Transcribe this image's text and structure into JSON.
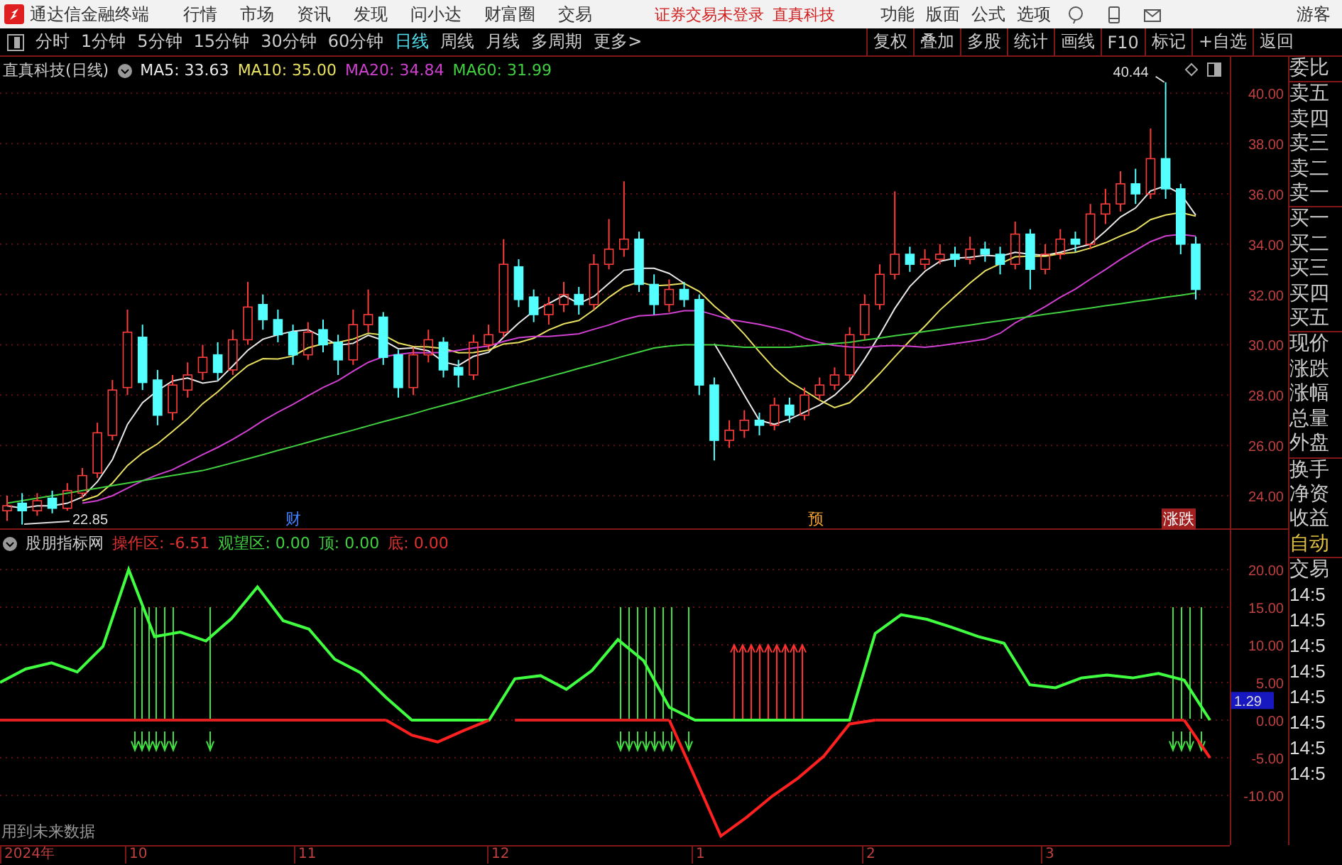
{
  "app": {
    "name": "通达信金融终端"
  },
  "menu": [
    "行情",
    "市场",
    "资讯",
    "发现",
    "问小达",
    "财富圈",
    "交易"
  ],
  "login_status": {
    "message": "证券交易未登录",
    "stock": "直真科技"
  },
  "top_actions": [
    "功能",
    "版面",
    "公式",
    "选项"
  ],
  "user": "游客",
  "periods": [
    {
      "label": "分时",
      "selected": false
    },
    {
      "label": "1分钟",
      "selected": false
    },
    {
      "label": "5分钟",
      "selected": false
    },
    {
      "label": "15分钟",
      "selected": false
    },
    {
      "label": "30分钟",
      "selected": false
    },
    {
      "label": "60分钟",
      "selected": false
    },
    {
      "label": "日线",
      "selected": true
    },
    {
      "label": "周线",
      "selected": false
    },
    {
      "label": "月线",
      "selected": false
    },
    {
      "label": "多周期",
      "selected": false
    },
    {
      "label": "更多>",
      "selected": false
    }
  ],
  "tools": [
    "复权",
    "叠加",
    "多股",
    "统计",
    "画线",
    "F10",
    "标记",
    "+自选",
    "返回"
  ],
  "main_chart": {
    "title": "直真科技(日线)",
    "ma": [
      {
        "label": "MA5: 33.63",
        "color": "#e8e8e8"
      },
      {
        "label": "MA10: 35.00",
        "color": "#e8e060"
      },
      {
        "label": "MA20: 34.84",
        "color": "#d040d0"
      },
      {
        "label": "MA60: 31.99",
        "color": "#40d040"
      }
    ],
    "high_label": "40.44",
    "low_label": "22.85",
    "events": [
      {
        "label": "财",
        "kind": "finance"
      },
      {
        "label": "预",
        "kind": "forecast"
      },
      {
        "label": "涨跌",
        "kind": "limit"
      }
    ],
    "chart_data": {
      "type": "candlestick",
      "grid": true,
      "ylim": [
        22.7,
        41.45
      ],
      "ohlc": [
        [
          23.4,
          24.0,
          23.0,
          23.6
        ],
        [
          23.7,
          24.1,
          22.85,
          23.4
        ],
        [
          23.4,
          24.1,
          23.2,
          23.8
        ],
        [
          23.9,
          24.2,
          23.3,
          23.5
        ],
        [
          23.5,
          24.5,
          23.4,
          24.2
        ],
        [
          24.1,
          25.1,
          23.9,
          24.8
        ],
        [
          24.9,
          26.9,
          24.7,
          26.5
        ],
        [
          26.4,
          28.6,
          26.2,
          28.2
        ],
        [
          28.3,
          31.4,
          28.0,
          30.5
        ],
        [
          30.3,
          30.8,
          28.2,
          28.5
        ],
        [
          28.6,
          29.0,
          26.8,
          27.2
        ],
        [
          27.3,
          28.8,
          27.0,
          28.4
        ],
        [
          28.2,
          29.3,
          27.9,
          28.8
        ],
        [
          28.9,
          30.0,
          28.6,
          29.5
        ],
        [
          29.6,
          30.1,
          28.6,
          28.9
        ],
        [
          29.0,
          30.6,
          28.8,
          30.2
        ],
        [
          30.2,
          32.5,
          30.0,
          31.5
        ],
        [
          31.6,
          32.0,
          30.6,
          31.0
        ],
        [
          31.0,
          31.4,
          30.1,
          30.4
        ],
        [
          30.5,
          30.8,
          29.2,
          29.6
        ],
        [
          29.6,
          30.9,
          29.4,
          30.5
        ],
        [
          30.6,
          31.0,
          29.7,
          30.0
        ],
        [
          30.1,
          30.4,
          28.8,
          29.4
        ],
        [
          29.4,
          31.4,
          29.2,
          30.8
        ],
        [
          30.8,
          32.2,
          30.5,
          31.2
        ],
        [
          31.1,
          31.3,
          29.2,
          29.5
        ],
        [
          29.6,
          29.8,
          27.9,
          28.3
        ],
        [
          28.3,
          29.9,
          28.0,
          29.6
        ],
        [
          29.6,
          30.6,
          29.3,
          30.2
        ],
        [
          30.1,
          30.3,
          28.7,
          29.0
        ],
        [
          29.1,
          29.4,
          28.3,
          28.8
        ],
        [
          28.8,
          30.4,
          28.6,
          30.1
        ],
        [
          30.0,
          30.8,
          29.8,
          30.4
        ],
        [
          30.5,
          34.2,
          30.3,
          33.2
        ],
        [
          33.1,
          33.4,
          31.5,
          31.8
        ],
        [
          31.9,
          32.2,
          30.9,
          31.2
        ],
        [
          31.2,
          31.9,
          30.8,
          31.6
        ],
        [
          31.6,
          32.5,
          31.3,
          32.0
        ],
        [
          32.0,
          32.3,
          31.2,
          31.6
        ],
        [
          31.6,
          33.6,
          31.4,
          33.2
        ],
        [
          33.2,
          35.0,
          33.0,
          33.8
        ],
        [
          33.8,
          36.5,
          33.5,
          34.2
        ],
        [
          34.2,
          34.5,
          32.1,
          32.4
        ],
        [
          32.4,
          32.8,
          31.2,
          31.6
        ],
        [
          31.6,
          32.6,
          31.3,
          32.2
        ],
        [
          32.2,
          32.5,
          31.5,
          31.8
        ],
        [
          31.8,
          32.0,
          28.0,
          28.4
        ],
        [
          28.4,
          28.7,
          25.4,
          26.2
        ],
        [
          26.2,
          27.0,
          25.9,
          26.6
        ],
        [
          26.6,
          27.4,
          26.3,
          27.0
        ],
        [
          27.0,
          27.3,
          26.4,
          26.8
        ],
        [
          26.8,
          27.9,
          26.6,
          27.6
        ],
        [
          27.6,
          27.9,
          26.9,
          27.2
        ],
        [
          27.2,
          28.3,
          27.0,
          28.0
        ],
        [
          28.0,
          28.7,
          27.8,
          28.4
        ],
        [
          28.4,
          29.1,
          28.2,
          28.8
        ],
        [
          28.8,
          30.7,
          28.6,
          30.4
        ],
        [
          30.4,
          32.0,
          30.2,
          31.6
        ],
        [
          31.6,
          33.2,
          31.4,
          32.8
        ],
        [
          32.8,
          36.1,
          32.6,
          33.6
        ],
        [
          33.6,
          33.9,
          32.9,
          33.2
        ],
        [
          33.2,
          33.8,
          33.0,
          33.4
        ],
        [
          33.4,
          34.0,
          33.2,
          33.6
        ],
        [
          33.6,
          33.9,
          33.1,
          33.4
        ],
        [
          33.4,
          34.3,
          33.2,
          33.8
        ],
        [
          33.8,
          34.1,
          33.3,
          33.6
        ],
        [
          33.6,
          33.9,
          32.8,
          33.2
        ],
        [
          33.2,
          34.9,
          33.0,
          34.4
        ],
        [
          34.4,
          34.6,
          32.2,
          33.0
        ],
        [
          33.0,
          34.0,
          32.8,
          33.6
        ],
        [
          33.6,
          34.6,
          33.4,
          34.2
        ],
        [
          34.2,
          34.5,
          33.7,
          34.0
        ],
        [
          34.0,
          35.6,
          33.8,
          35.2
        ],
        [
          35.2,
          36.2,
          34.8,
          35.6
        ],
        [
          35.6,
          36.9,
          35.3,
          36.4
        ],
        [
          36.4,
          37.0,
          35.6,
          36.0
        ],
        [
          36.0,
          38.6,
          35.8,
          37.4
        ],
        [
          37.4,
          40.44,
          35.8,
          36.2
        ],
        [
          36.2,
          36.4,
          33.6,
          34.0
        ],
        [
          34.0,
          34.3,
          31.8,
          32.2
        ]
      ],
      "series": [
        {
          "type": "line",
          "color": "#e8e8e8",
          "values": [
            23.6,
            23.5,
            23.6,
            23.6,
            23.7,
            23.94,
            24.56,
            25.44,
            26.84,
            27.7,
            28.18,
            28.56,
            28.68,
            28.48,
            28.56,
            29.16,
            29.78,
            30.22,
            30.4,
            30.54,
            30.6,
            30.3,
            29.98,
            30.06,
            30.38,
            30.18,
            29.84,
            29.88,
            29.76,
            29.32,
            29.18,
            29.54,
            29.7,
            30.3,
            30.86,
            31.34,
            31.64,
            31.96,
            31.64,
            31.92,
            32.44,
            32.96,
            33.04,
            33.04,
            32.84,
            32.44,
            null,
            30.04,
            29.04,
            28.0,
            27.0,
            26.84,
            27.04,
            27.32,
            27.6,
            28.0,
            28.56,
            29.44,
            30.4,
            31.44,
            32.32,
            32.92,
            33.32,
            33.44,
            33.48,
            33.56,
            33.52,
            33.68,
            33.6,
            33.56,
            33.68,
            33.84,
            34.0,
            34.52,
            35.08,
            35.44,
            36.12,
            36.32,
            36.0,
            35.16
          ]
        },
        {
          "type": "line",
          "color": "#e8e060",
          "values": [
            null,
            null,
            null,
            null,
            null,
            23.8,
            24.0,
            24.5,
            25.2,
            25.7,
            26.06,
            26.56,
            27.06,
            27.66,
            28.13,
            28.67,
            29.17,
            29.45,
            29.44,
            29.55,
            29.88,
            30.04,
            30.1,
            30.23,
            30.46,
            30.39,
            30.07,
            29.93,
            29.91,
            29.85,
            29.68,
            29.69,
            29.79,
            30.03,
            30.09,
            30.26,
            30.59,
            30.83,
            30.97,
            31.39,
            31.89,
            32.3,
            32.5,
            32.34,
            32.38,
            32.44,
            32.12,
            31.54,
            31.04,
            30.42,
            29.72,
            29.06,
            28.54,
            28.18,
            27.8,
            27.5,
            27.7,
            28.24,
            28.86,
            29.52,
            30.16,
            30.74,
            31.38,
            31.92,
            32.46,
            32.94,
            33.22,
            33.5,
            33.52,
            33.52,
            33.62,
            33.68,
            33.84,
            34.06,
            34.32,
            34.56,
            34.98,
            35.16,
            35.26,
            35.12
          ]
        },
        {
          "type": "line",
          "color": "#d040d0",
          "values": [
            null,
            null,
            null,
            null,
            null,
            23.7,
            23.8,
            24.0,
            24.3,
            24.6,
            24.83,
            25.03,
            25.33,
            25.63,
            25.92,
            26.24,
            26.59,
            26.98,
            27.32,
            27.63,
            27.97,
            28.3,
            28.58,
            28.95,
            29.3,
            29.53,
            29.62,
            29.69,
            29.68,
            29.7,
            29.78,
            29.87,
            29.95,
            30.13,
            30.28,
            30.33,
            30.33,
            30.38,
            30.44,
            30.62,
            30.79,
            31.0,
            31.15,
            31.19,
            31.24,
            31.35,
            31.36,
            31.19,
            31.01,
            30.91,
            30.81,
            30.68,
            30.52,
            30.26,
            30.09,
            29.97,
            29.91,
            29.89,
            29.95,
            29.97,
            29.94,
            29.9,
            29.96,
            30.05,
            30.13,
            30.22,
            30.46,
            30.87,
            31.19,
            31.52,
            31.89,
            32.21,
            32.61,
            32.99,
            33.39,
            33.75,
            34.1,
            34.33,
            34.39,
            34.32
          ]
        },
        {
          "type": "line",
          "color": "#40d040",
          "values": [
            23.7,
            23.8,
            23.9,
            24.0,
            24.1,
            24.2,
            24.3,
            24.4,
            24.5,
            24.6,
            24.7,
            24.8,
            24.9,
            25.0,
            25.15,
            25.31,
            25.47,
            25.63,
            25.8,
            25.96,
            26.12,
            26.29,
            26.45,
            26.61,
            26.78,
            26.94,
            27.1,
            27.26,
            27.43,
            27.59,
            27.75,
            27.92,
            28.08,
            28.24,
            28.41,
            28.57,
            28.73,
            28.89,
            29.06,
            29.22,
            29.38,
            29.55,
            29.71,
            29.87,
            29.95,
            30.0,
            30.0,
            30.0,
            29.95,
            29.9,
            29.9,
            29.9,
            29.9,
            29.95,
            30.0,
            30.05,
            30.1,
            30.19,
            30.27,
            30.36,
            30.44,
            30.53,
            30.61,
            30.7,
            30.78,
            30.87,
            30.95,
            31.04,
            31.12,
            31.21,
            31.29,
            31.38,
            31.46,
            31.55,
            31.63,
            31.72,
            31.8,
            31.89,
            31.97,
            32.06
          ]
        }
      ],
      "yticks": [
        {
          "value": 40,
          "label": "40.00"
        },
        {
          "value": 38,
          "label": "38.00"
        },
        {
          "value": 36,
          "label": "36.00"
        },
        {
          "value": 34,
          "label": "34.00"
        },
        {
          "value": 32,
          "label": "32.00"
        },
        {
          "value": 30,
          "label": "30.00"
        },
        {
          "value": 28,
          "label": "28.00"
        },
        {
          "value": 26,
          "label": "26.00"
        },
        {
          "value": 24,
          "label": "24.00"
        }
      ]
    }
  },
  "indicator": {
    "name": "股朋指标网",
    "values": [
      {
        "label": "操作区:",
        "value": "-6.51",
        "color": "#e03030"
      },
      {
        "label": "观望区:",
        "value": "0.00",
        "color": "#40d040"
      },
      {
        "label": "顶:",
        "value": "0.00",
        "color": "#40d040"
      },
      {
        "label": "底:",
        "value": "0.00",
        "color": "#e03030"
      }
    ],
    "current": "1.29",
    "note": "用到未来数据",
    "chart_data": {
      "type": "line",
      "grid": true,
      "ylim": [
        -16.6,
        25.28
      ],
      "series": [
        {
          "color": "#e02020",
          "values": [
            0,
            0,
            0,
            0,
            0,
            0,
            0,
            0,
            0,
            0,
            0,
            0,
            0,
            0,
            0,
            0,
            null,
            null,
            null,
            null,
            0,
            0,
            0,
            0,
            0,
            0,
            0,
            null,
            null,
            null,
            null,
            null,
            null,
            null,
            0,
            0,
            0,
            0,
            0,
            0,
            0,
            0,
            0,
            0,
            0,
            0,
            0,
            null
          ]
        },
        {
          "color": "#40ff40",
          "values": [
            5,
            6.8,
            7.6,
            6.4,
            9.8,
            20,
            11.1,
            11.7,
            10.5,
            13.5,
            17.7,
            13.2,
            12.1,
            8.1,
            6.3,
            3,
            0,
            0,
            0,
            0,
            5.5,
            5.9,
            4.1,
            6.6,
            10.7,
            7.9,
            1.7,
            0,
            0,
            0,
            0,
            0,
            0,
            0,
            11.5,
            14,
            13.4,
            12.3,
            11.1,
            10.2,
            4.7,
            4.3,
            5.6,
            6,
            5.6,
            6.2,
            5.3,
            0
          ]
        },
        {
          "color": "#ff2020",
          "values": [
            null,
            null,
            null,
            null,
            null,
            null,
            null,
            null,
            null,
            null,
            null,
            null,
            null,
            null,
            null,
            0,
            -2,
            -2.9,
            -1.4,
            0,
            null,
            null,
            null,
            null,
            null,
            null,
            0,
            -7.6,
            -15.4,
            -12.9,
            -10.1,
            -7.7,
            -4.8,
            -0.5,
            0,
            null,
            null,
            null,
            null,
            null,
            null,
            null,
            null,
            null,
            null,
            null,
            0,
            -5
          ]
        }
      ],
      "yticks": [
        {
          "value": 20,
          "label": "20.00"
        },
        {
          "value": 15,
          "label": "15.00"
        },
        {
          "value": 10,
          "label": "10.00"
        },
        {
          "value": 5,
          "label": "5.00"
        },
        {
          "value": 0,
          "label": "0.00"
        },
        {
          "value": -5,
          "label": "-5.00"
        },
        {
          "value": -10,
          "label": "-10.00"
        }
      ]
    }
  },
  "time_axis": [
    "2024年",
    "10",
    "11",
    "12",
    "1",
    "2",
    "3"
  ],
  "quote_panel": {
    "labels": [
      "委比",
      "卖五",
      "卖四",
      "卖三",
      "卖二",
      "卖一",
      "买一",
      "买二",
      "买三",
      "买四",
      "买五",
      "现价",
      "涨跌",
      "涨幅",
      "总量",
      "外盘",
      "换手",
      "净资",
      "收益"
    ],
    "mode": [
      "自动",
      "交易"
    ],
    "times": [
      "14:5",
      "14:5",
      "14:5",
      "14:5",
      "14:5",
      "14:5",
      "14:5",
      "14:5"
    ]
  }
}
